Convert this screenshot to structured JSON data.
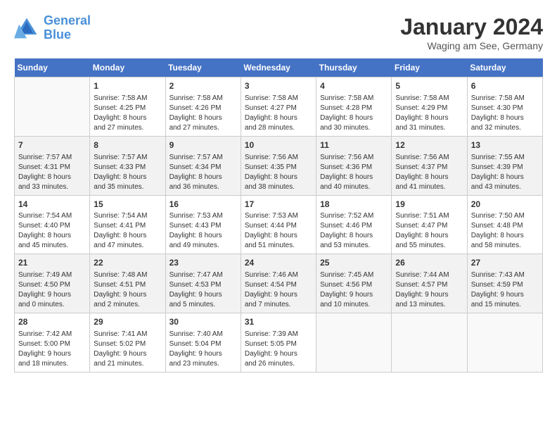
{
  "logo": {
    "line1": "General",
    "line2": "Blue"
  },
  "title": "January 2024",
  "location": "Waging am See, Germany",
  "days_of_week": [
    "Sunday",
    "Monday",
    "Tuesday",
    "Wednesday",
    "Thursday",
    "Friday",
    "Saturday"
  ],
  "weeks": [
    [
      {
        "day": "",
        "content": ""
      },
      {
        "day": "1",
        "content": "Sunrise: 7:58 AM\nSunset: 4:25 PM\nDaylight: 8 hours\nand 27 minutes."
      },
      {
        "day": "2",
        "content": "Sunrise: 7:58 AM\nSunset: 4:26 PM\nDaylight: 8 hours\nand 27 minutes."
      },
      {
        "day": "3",
        "content": "Sunrise: 7:58 AM\nSunset: 4:27 PM\nDaylight: 8 hours\nand 28 minutes."
      },
      {
        "day": "4",
        "content": "Sunrise: 7:58 AM\nSunset: 4:28 PM\nDaylight: 8 hours\nand 30 minutes."
      },
      {
        "day": "5",
        "content": "Sunrise: 7:58 AM\nSunset: 4:29 PM\nDaylight: 8 hours\nand 31 minutes."
      },
      {
        "day": "6",
        "content": "Sunrise: 7:58 AM\nSunset: 4:30 PM\nDaylight: 8 hours\nand 32 minutes."
      }
    ],
    [
      {
        "day": "7",
        "content": "Sunrise: 7:57 AM\nSunset: 4:31 PM\nDaylight: 8 hours\nand 33 minutes."
      },
      {
        "day": "8",
        "content": "Sunrise: 7:57 AM\nSunset: 4:33 PM\nDaylight: 8 hours\nand 35 minutes."
      },
      {
        "day": "9",
        "content": "Sunrise: 7:57 AM\nSunset: 4:34 PM\nDaylight: 8 hours\nand 36 minutes."
      },
      {
        "day": "10",
        "content": "Sunrise: 7:56 AM\nSunset: 4:35 PM\nDaylight: 8 hours\nand 38 minutes."
      },
      {
        "day": "11",
        "content": "Sunrise: 7:56 AM\nSunset: 4:36 PM\nDaylight: 8 hours\nand 40 minutes."
      },
      {
        "day": "12",
        "content": "Sunrise: 7:56 AM\nSunset: 4:37 PM\nDaylight: 8 hours\nand 41 minutes."
      },
      {
        "day": "13",
        "content": "Sunrise: 7:55 AM\nSunset: 4:39 PM\nDaylight: 8 hours\nand 43 minutes."
      }
    ],
    [
      {
        "day": "14",
        "content": "Sunrise: 7:54 AM\nSunset: 4:40 PM\nDaylight: 8 hours\nand 45 minutes."
      },
      {
        "day": "15",
        "content": "Sunrise: 7:54 AM\nSunset: 4:41 PM\nDaylight: 8 hours\nand 47 minutes."
      },
      {
        "day": "16",
        "content": "Sunrise: 7:53 AM\nSunset: 4:43 PM\nDaylight: 8 hours\nand 49 minutes."
      },
      {
        "day": "17",
        "content": "Sunrise: 7:53 AM\nSunset: 4:44 PM\nDaylight: 8 hours\nand 51 minutes."
      },
      {
        "day": "18",
        "content": "Sunrise: 7:52 AM\nSunset: 4:46 PM\nDaylight: 8 hours\nand 53 minutes."
      },
      {
        "day": "19",
        "content": "Sunrise: 7:51 AM\nSunset: 4:47 PM\nDaylight: 8 hours\nand 55 minutes."
      },
      {
        "day": "20",
        "content": "Sunrise: 7:50 AM\nSunset: 4:48 PM\nDaylight: 8 hours\nand 58 minutes."
      }
    ],
    [
      {
        "day": "21",
        "content": "Sunrise: 7:49 AM\nSunset: 4:50 PM\nDaylight: 9 hours\nand 0 minutes."
      },
      {
        "day": "22",
        "content": "Sunrise: 7:48 AM\nSunset: 4:51 PM\nDaylight: 9 hours\nand 2 minutes."
      },
      {
        "day": "23",
        "content": "Sunrise: 7:47 AM\nSunset: 4:53 PM\nDaylight: 9 hours\nand 5 minutes."
      },
      {
        "day": "24",
        "content": "Sunrise: 7:46 AM\nSunset: 4:54 PM\nDaylight: 9 hours\nand 7 minutes."
      },
      {
        "day": "25",
        "content": "Sunrise: 7:45 AM\nSunset: 4:56 PM\nDaylight: 9 hours\nand 10 minutes."
      },
      {
        "day": "26",
        "content": "Sunrise: 7:44 AM\nSunset: 4:57 PM\nDaylight: 9 hours\nand 13 minutes."
      },
      {
        "day": "27",
        "content": "Sunrise: 7:43 AM\nSunset: 4:59 PM\nDaylight: 9 hours\nand 15 minutes."
      }
    ],
    [
      {
        "day": "28",
        "content": "Sunrise: 7:42 AM\nSunset: 5:00 PM\nDaylight: 9 hours\nand 18 minutes."
      },
      {
        "day": "29",
        "content": "Sunrise: 7:41 AM\nSunset: 5:02 PM\nDaylight: 9 hours\nand 21 minutes."
      },
      {
        "day": "30",
        "content": "Sunrise: 7:40 AM\nSunset: 5:04 PM\nDaylight: 9 hours\nand 23 minutes."
      },
      {
        "day": "31",
        "content": "Sunrise: 7:39 AM\nSunset: 5:05 PM\nDaylight: 9 hours\nand 26 minutes."
      },
      {
        "day": "",
        "content": ""
      },
      {
        "day": "",
        "content": ""
      },
      {
        "day": "",
        "content": ""
      }
    ]
  ]
}
